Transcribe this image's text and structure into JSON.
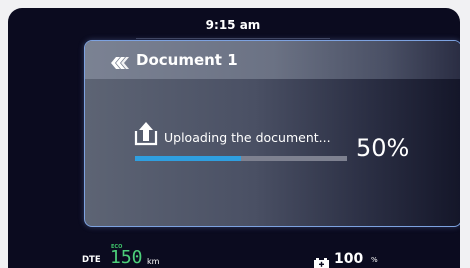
{
  "status": {
    "time": "9:15 am"
  },
  "dialog": {
    "title": "Document 1",
    "back_icon": "double-chevron-left-icon",
    "upload_icon": "upload-icon",
    "message": "Uploading the document...",
    "progress_percent": 50,
    "progress_label": "50%"
  },
  "footer": {
    "dte_label": "DTE",
    "eco_label": "ECO",
    "range_value": "150",
    "range_unit": "km",
    "battery_icon": "battery-icon",
    "battery_value": "100",
    "battery_unit": "%"
  },
  "colors": {
    "background": "#0b0b1f",
    "accent": "#2f9fe0",
    "eco_green": "#4cd07a",
    "dialog_border": "#7da2e0"
  }
}
